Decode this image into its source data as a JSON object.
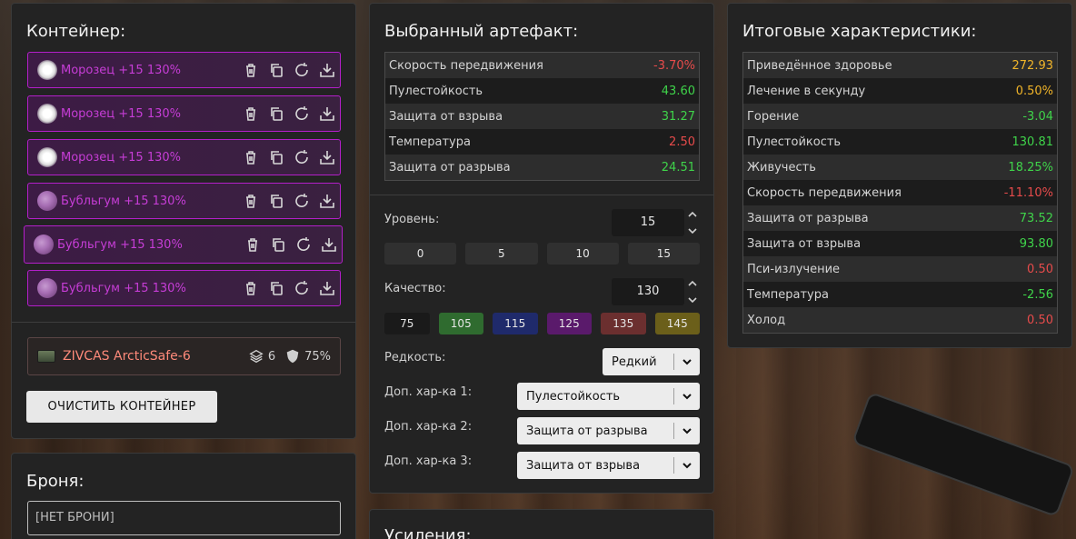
{
  "container": {
    "title": "Контейнер:",
    "items": [
      {
        "name": "Морозец +15 130%",
        "icon": "frost-artifact-icon"
      },
      {
        "name": "Морозец +15 130%",
        "icon": "frost-artifact-icon"
      },
      {
        "name": "Морозец +15 130%",
        "icon": "frost-artifact-icon"
      },
      {
        "name": "Бубльгум +15 130%",
        "icon": "bubblegum-artifact-icon"
      },
      {
        "name": "Бубльгум +15 130%",
        "icon": "bubblegum-artifact-icon"
      },
      {
        "name": "Бубльгум +15 130%",
        "icon": "bubblegum-artifact-icon"
      }
    ],
    "item_actions": [
      "trash-icon",
      "copy-icon",
      "refresh-icon",
      "download-icon"
    ],
    "item_color": "#c63dd6",
    "item_border": "#b31fc9",
    "safe": {
      "name": "ZIVCAS ArcticSafe-6",
      "slots": "6",
      "protection": "75%"
    },
    "clear_button": "ОЧИСТИТЬ КОНТЕЙНЕР"
  },
  "armor": {
    "title": "Броня:",
    "value": "[НЕТ БРОНИ]"
  },
  "artifact": {
    "title": "Выбранный артефакт:",
    "stats": [
      {
        "label": "Скорость передвижения",
        "value": "-3.70%",
        "tone": "neg"
      },
      {
        "label": "Пулестойкость",
        "value": "43.60",
        "tone": "pos"
      },
      {
        "label": "Защита от взрыва",
        "value": "31.27",
        "tone": "pos"
      },
      {
        "label": "Температура",
        "value": "2.50",
        "tone": "neg"
      },
      {
        "label": "Защита от разрыва",
        "value": "24.51",
        "tone": "pos"
      }
    ],
    "level_label": "Уровень:",
    "level_value": "15",
    "level_buttons": [
      "0",
      "5",
      "10",
      "15"
    ],
    "quality_label": "Качество:",
    "quality_value": "130",
    "quality_buttons": [
      {
        "label": "75",
        "color": "#1a1a1a"
      },
      {
        "label": "105",
        "color": "#2f6b2f"
      },
      {
        "label": "115",
        "color": "#1f2a6b"
      },
      {
        "label": "125",
        "color": "#5a1a6b"
      },
      {
        "label": "135",
        "color": "#6b2f2f"
      },
      {
        "label": "145",
        "color": "#6b5f1a"
      }
    ],
    "rarity_label": "Редкость:",
    "rarity_value": "Редкий",
    "extra1_label": "Доп. хар-ка 1:",
    "extra1_value": "Пулестойкость",
    "extra2_label": "Доп. хар-ка 2:",
    "extra2_value": "Защита от разрыва",
    "extra3_label": "Доп. хар-ка 3:",
    "extra3_value": "Защита от взрыва"
  },
  "summary": {
    "title": "Итоговые характеристики:",
    "stats": [
      {
        "label": "Приведённое здоровье",
        "value": "272.93",
        "tone": "gold"
      },
      {
        "label": "Лечение в секунду",
        "value": "0.50%",
        "tone": "gold"
      },
      {
        "label": "Горение",
        "value": "-3.04",
        "tone": "pos"
      },
      {
        "label": "Пулестойкость",
        "value": "130.81",
        "tone": "pos"
      },
      {
        "label": "Живучесть",
        "value": "18.25%",
        "tone": "pos"
      },
      {
        "label": "Скорость передвижения",
        "value": "-11.10%",
        "tone": "neg"
      },
      {
        "label": "Защита от разрыва",
        "value": "73.52",
        "tone": "pos"
      },
      {
        "label": "Защита от взрыва",
        "value": "93.80",
        "tone": "pos"
      },
      {
        "label": "Пси-излучение",
        "value": "0.50",
        "tone": "neg"
      },
      {
        "label": "Температура",
        "value": "-2.56",
        "tone": "pos"
      },
      {
        "label": "Холод",
        "value": "0.50",
        "tone": "neg"
      }
    ]
  },
  "boosts": {
    "title": "Усиления:"
  }
}
